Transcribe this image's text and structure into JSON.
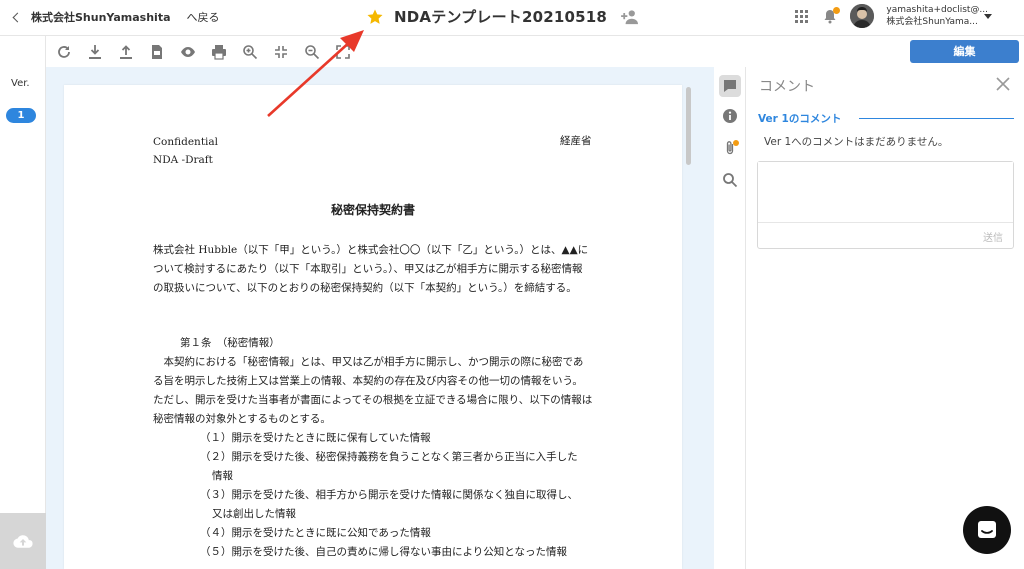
{
  "header": {
    "org": "株式会社ShunYamashita",
    "back_label": "へ戻る",
    "doc_title": "NDAテンプレート20210518",
    "user_email": "yamashita+doclist@...",
    "user_org": "株式会社ShunYama..."
  },
  "rail": {
    "ver_label": "Ver.",
    "ver_number": "1"
  },
  "toolbar": {
    "edit_label": "編集"
  },
  "document": {
    "confidential": "Confidential",
    "draft": "NDA -Draft",
    "ministry": "経産省",
    "title": "秘密保持契約書",
    "intro": "株式会社 Hubble（以下「甲」という。）と株式会社〇〇（以下「乙」という。）とは、▲▲について検討するにあたり（以下「本取引」という。）、甲又は乙が相手方に開示する秘密情報の取扱いについて、以下のとおりの秘密保持契約（以下「本契約」という。）を締結する。",
    "article1_heading": "第１条　（秘密情報）",
    "article1_body": "本契約における「秘密情報」とは、甲又は乙が相手方に開示し、かつ開示の際に秘密である旨を明示した技術上又は営業上の情報、本契約の存在及び内容その他一切の情報をいう。 ただし、開示を受けた当事者が書面によってその根拠を立証できる場合に限り、以下の情報は秘密情報の対象外とするものとする。",
    "item1": "（１）開示を受けたときに既に保有していた情報",
    "item2": "（２）開示を受けた後、秘密保持義務を負うことなく第三者から正当に入手した",
    "item2_cont": "情報",
    "item3": "（３）開示を受けた後、相手方から開示を受けた情報に関係なく独自に取得し、",
    "item3_cont": "又は創出した情報",
    "item4": "（４）開示を受けたときに既に公知であった情報",
    "item5": "（５）開示を受けた後、自己の責めに帰し得ない事由により公知となった情報"
  },
  "comments": {
    "title": "コメント",
    "version_heading": "Ver 1のコメント",
    "empty_message": "Ver 1へのコメントはまだありません。",
    "input_placeholder": "",
    "send_label": "送信"
  },
  "colors": {
    "accent_blue": "#2e86de",
    "edit_button": "#3c7fce",
    "star": "#f5b800",
    "annotation_arrow": "#e8392a",
    "notification_dot": "#f39c12"
  }
}
